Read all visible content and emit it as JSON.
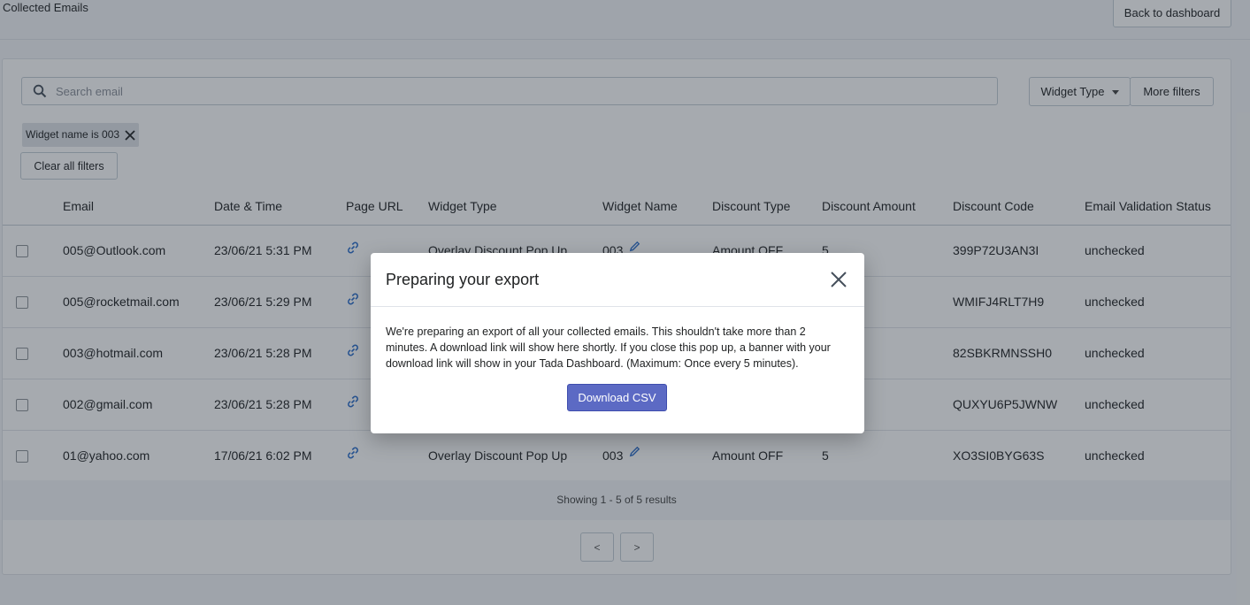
{
  "header": {
    "title": "Collected Emails",
    "back_label": "Back to dashboard"
  },
  "filters": {
    "search_placeholder": "Search email",
    "widget_type_label": "Widget Type",
    "more_filters_label": "More filters",
    "active_chip": "Widget name is 003",
    "clear_label": "Clear all filters"
  },
  "table": {
    "columns": [
      "Email",
      "Date & Time",
      "Page URL",
      "Widget Type",
      "Widget Name",
      "Discount Type",
      "Discount Amount",
      "Discount Code",
      "Email Validation Status"
    ],
    "rows": [
      {
        "email": "005@Outlook.com",
        "date": "23/06/21 5:31 PM",
        "widget_type": "Overlay Discount Pop Up",
        "widget_name": "003",
        "discount_type": "Amount OFF",
        "discount_amount": "5",
        "code": "399P72U3AN3I",
        "status": "unchecked"
      },
      {
        "email": "005@rocketmail.com",
        "date": "23/06/21 5:29 PM",
        "widget_type": "",
        "widget_name": "",
        "discount_type": "",
        "discount_amount": "",
        "code": "WMIFJ4RLT7H9",
        "status": "unchecked"
      },
      {
        "email": "003@hotmail.com",
        "date": "23/06/21 5:28 PM",
        "widget_type": "",
        "widget_name": "",
        "discount_type": "",
        "discount_amount": "",
        "code": "82SBKRMNSSH0",
        "status": "unchecked"
      },
      {
        "email": "002@gmail.com",
        "date": "23/06/21 5:28 PM",
        "widget_type": "",
        "widget_name": "",
        "discount_type": "",
        "discount_amount": "",
        "code": "QUXYU6P5JWNW",
        "status": "unchecked"
      },
      {
        "email": "01@yahoo.com",
        "date": "17/06/21 6:02 PM",
        "widget_type": "Overlay Discount Pop Up",
        "widget_name": "003",
        "discount_type": "Amount OFF",
        "discount_amount": "5",
        "code": "XO3SI0BYG63S",
        "status": "unchecked"
      }
    ],
    "footer": "Showing 1 - 5 of 5 results"
  },
  "pager": {
    "prev": "<",
    "next": ">"
  },
  "modal": {
    "title": "Preparing your export",
    "body": "We're preparing an export of all your collected emails. This shouldn't take more than 2 minutes. A download link will show here shortly. If you close this pop up, a banner with your download link will show in your Tada Dashboard. (Maximum: Once every 5 minutes).",
    "button": "Download CSV"
  },
  "colors": {
    "primary": "#5c6ac4",
    "link_icon": "#2c6ecb",
    "overlay": "rgba(33,43,54,0.4)"
  }
}
